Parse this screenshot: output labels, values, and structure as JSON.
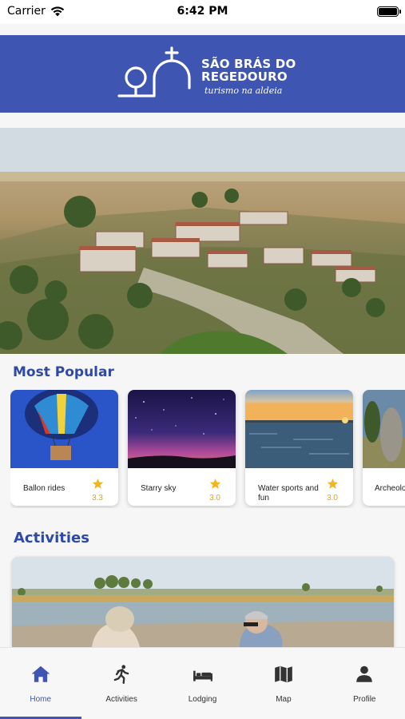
{
  "status_bar": {
    "carrier": "Carrier",
    "time": "6:42 PM"
  },
  "brand": {
    "line1": "SÃO BRÁS DO",
    "line2": "REGEDOURO",
    "subtitle": "turismo na aldeia"
  },
  "sections": {
    "most_popular": "Most Popular",
    "activities": "Activities"
  },
  "popular": [
    {
      "title": "Ballon rides",
      "rating": "3.3"
    },
    {
      "title": "Starry sky",
      "rating": "3.0"
    },
    {
      "title": "Water sports and fun",
      "rating": "3.0"
    },
    {
      "title": "Archeolo",
      "rating": ""
    }
  ],
  "tabs": [
    {
      "label": "Home",
      "icon": "home-icon",
      "active": true
    },
    {
      "label": "Activities",
      "icon": "running-person-icon",
      "active": false
    },
    {
      "label": "Lodging",
      "icon": "bed-icon",
      "active": false
    },
    {
      "label": "Map",
      "icon": "map-icon",
      "active": false
    },
    {
      "label": "Profile",
      "icon": "person-icon",
      "active": false
    }
  ],
  "colors": {
    "brand": "#3e55b2",
    "title": "#2f4aa6",
    "star": "#f2b61c"
  }
}
